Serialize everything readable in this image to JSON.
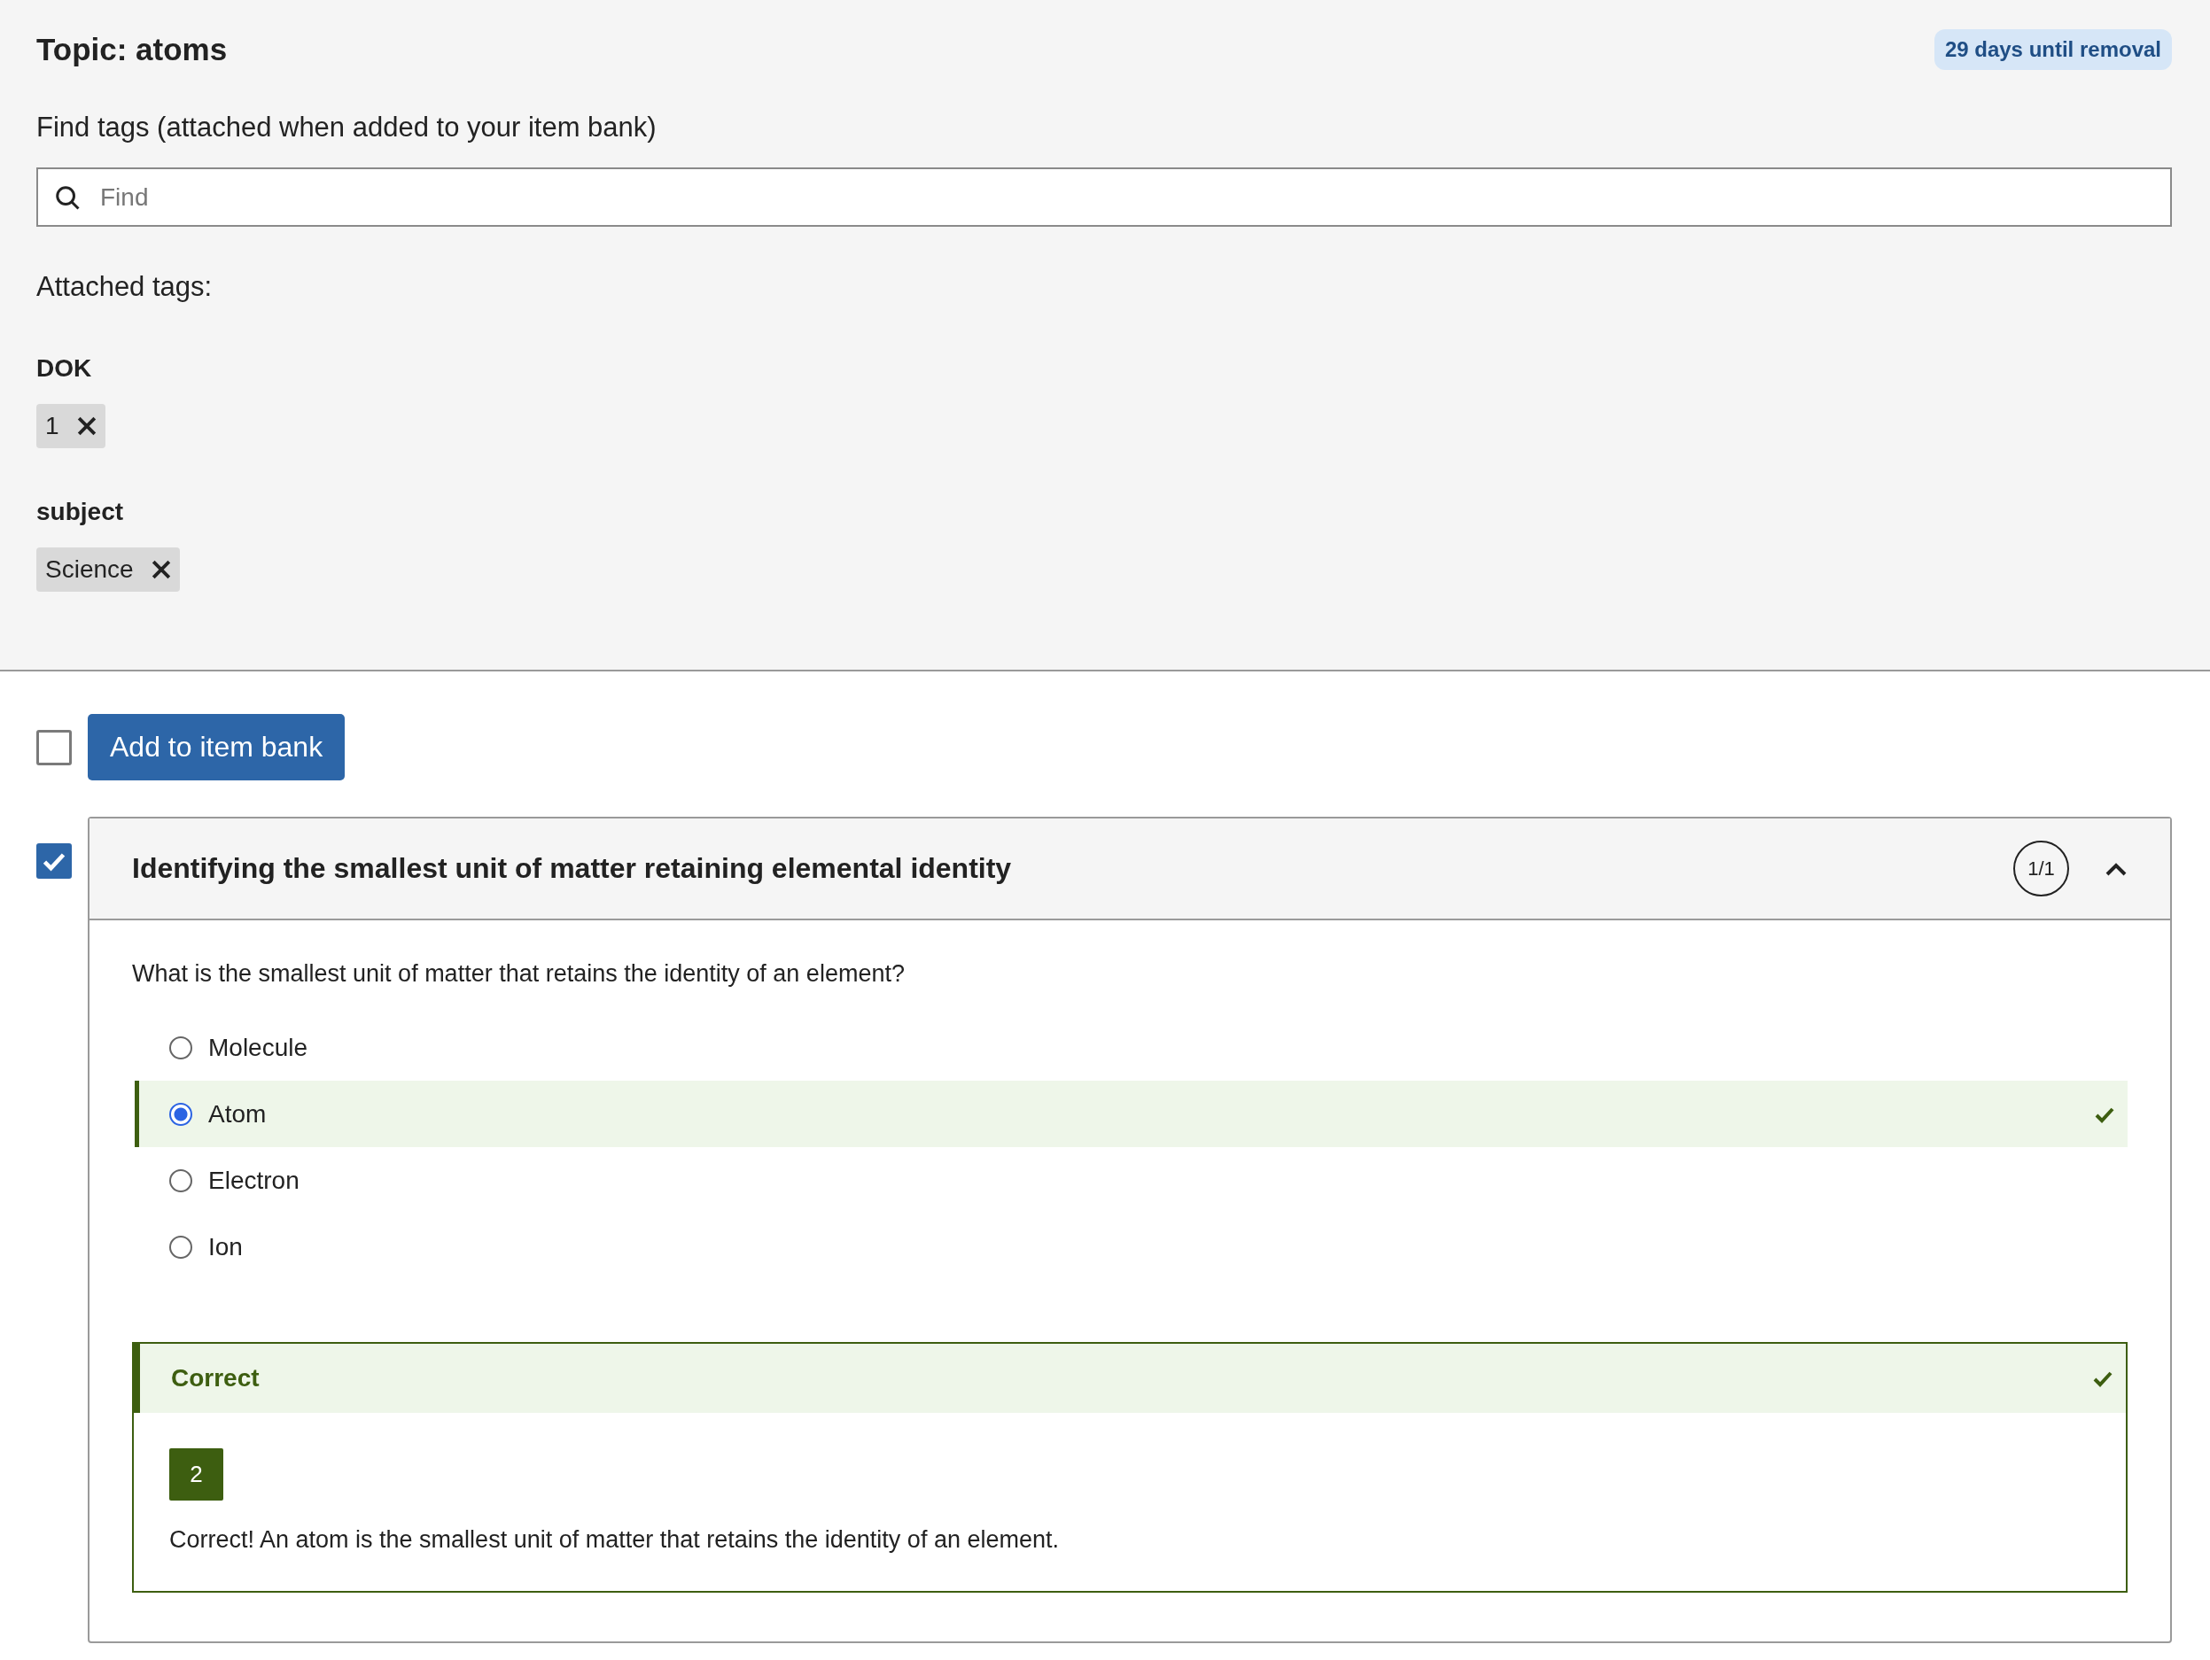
{
  "topic": {
    "title": "Topic: atoms",
    "badge": "29 days until removal"
  },
  "tag_search": {
    "label": "Find tags (attached when added to your item bank)",
    "placeholder": "Find"
  },
  "attached_label": "Attached tags:",
  "tag_groups": [
    {
      "name": "DOK",
      "tags": [
        "1"
      ]
    },
    {
      "name": "subject",
      "tags": [
        "Science"
      ]
    }
  ],
  "toolbar": {
    "select_all_checked": false,
    "add_button": "Add to item bank"
  },
  "question": {
    "checked": true,
    "title": "Identifying the smallest unit of matter retaining elemental identity",
    "counter": "1/1",
    "expanded": true,
    "prompt": "What is the smallest unit of matter that retains the identity of an element?",
    "options": [
      {
        "label": "Molecule",
        "selected": false,
        "correct": false
      },
      {
        "label": "Atom",
        "selected": true,
        "correct": true
      },
      {
        "label": "Electron",
        "selected": false,
        "correct": false
      },
      {
        "label": "Ion",
        "selected": false,
        "correct": false
      }
    ],
    "feedback": {
      "title": "Correct",
      "badge": "2",
      "text": "Correct! An atom is the smallest unit of matter that retains the identity of an element."
    }
  }
}
